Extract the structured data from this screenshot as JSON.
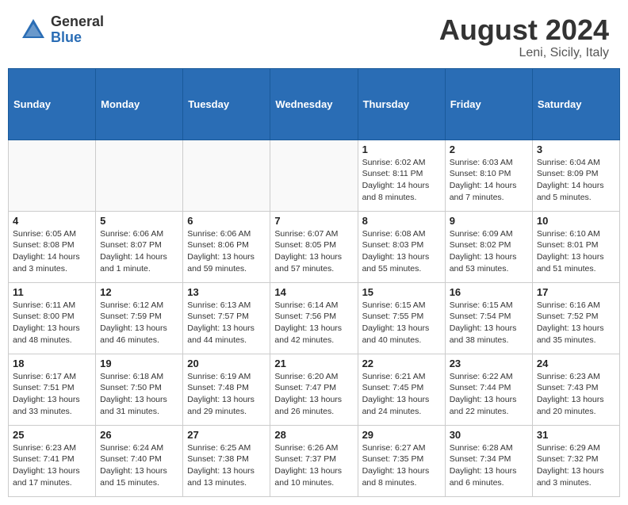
{
  "header": {
    "logo_general": "General",
    "logo_blue": "Blue",
    "month_title": "August 2024",
    "location": "Leni, Sicily, Italy"
  },
  "weekdays": [
    "Sunday",
    "Monday",
    "Tuesday",
    "Wednesday",
    "Thursday",
    "Friday",
    "Saturday"
  ],
  "weeks": [
    [
      {
        "day": "",
        "info": ""
      },
      {
        "day": "",
        "info": ""
      },
      {
        "day": "",
        "info": ""
      },
      {
        "day": "",
        "info": ""
      },
      {
        "day": "1",
        "info": "Sunrise: 6:02 AM\nSunset: 8:11 PM\nDaylight: 14 hours and 8 minutes."
      },
      {
        "day": "2",
        "info": "Sunrise: 6:03 AM\nSunset: 8:10 PM\nDaylight: 14 hours and 7 minutes."
      },
      {
        "day": "3",
        "info": "Sunrise: 6:04 AM\nSunset: 8:09 PM\nDaylight: 14 hours and 5 minutes."
      }
    ],
    [
      {
        "day": "4",
        "info": "Sunrise: 6:05 AM\nSunset: 8:08 PM\nDaylight: 14 hours and 3 minutes."
      },
      {
        "day": "5",
        "info": "Sunrise: 6:06 AM\nSunset: 8:07 PM\nDaylight: 14 hours and 1 minute."
      },
      {
        "day": "6",
        "info": "Sunrise: 6:06 AM\nSunset: 8:06 PM\nDaylight: 13 hours and 59 minutes."
      },
      {
        "day": "7",
        "info": "Sunrise: 6:07 AM\nSunset: 8:05 PM\nDaylight: 13 hours and 57 minutes."
      },
      {
        "day": "8",
        "info": "Sunrise: 6:08 AM\nSunset: 8:03 PM\nDaylight: 13 hours and 55 minutes."
      },
      {
        "day": "9",
        "info": "Sunrise: 6:09 AM\nSunset: 8:02 PM\nDaylight: 13 hours and 53 minutes."
      },
      {
        "day": "10",
        "info": "Sunrise: 6:10 AM\nSunset: 8:01 PM\nDaylight: 13 hours and 51 minutes."
      }
    ],
    [
      {
        "day": "11",
        "info": "Sunrise: 6:11 AM\nSunset: 8:00 PM\nDaylight: 13 hours and 48 minutes."
      },
      {
        "day": "12",
        "info": "Sunrise: 6:12 AM\nSunset: 7:59 PM\nDaylight: 13 hours and 46 minutes."
      },
      {
        "day": "13",
        "info": "Sunrise: 6:13 AM\nSunset: 7:57 PM\nDaylight: 13 hours and 44 minutes."
      },
      {
        "day": "14",
        "info": "Sunrise: 6:14 AM\nSunset: 7:56 PM\nDaylight: 13 hours and 42 minutes."
      },
      {
        "day": "15",
        "info": "Sunrise: 6:15 AM\nSunset: 7:55 PM\nDaylight: 13 hours and 40 minutes."
      },
      {
        "day": "16",
        "info": "Sunrise: 6:15 AM\nSunset: 7:54 PM\nDaylight: 13 hours and 38 minutes."
      },
      {
        "day": "17",
        "info": "Sunrise: 6:16 AM\nSunset: 7:52 PM\nDaylight: 13 hours and 35 minutes."
      }
    ],
    [
      {
        "day": "18",
        "info": "Sunrise: 6:17 AM\nSunset: 7:51 PM\nDaylight: 13 hours and 33 minutes."
      },
      {
        "day": "19",
        "info": "Sunrise: 6:18 AM\nSunset: 7:50 PM\nDaylight: 13 hours and 31 minutes."
      },
      {
        "day": "20",
        "info": "Sunrise: 6:19 AM\nSunset: 7:48 PM\nDaylight: 13 hours and 29 minutes."
      },
      {
        "day": "21",
        "info": "Sunrise: 6:20 AM\nSunset: 7:47 PM\nDaylight: 13 hours and 26 minutes."
      },
      {
        "day": "22",
        "info": "Sunrise: 6:21 AM\nSunset: 7:45 PM\nDaylight: 13 hours and 24 minutes."
      },
      {
        "day": "23",
        "info": "Sunrise: 6:22 AM\nSunset: 7:44 PM\nDaylight: 13 hours and 22 minutes."
      },
      {
        "day": "24",
        "info": "Sunrise: 6:23 AM\nSunset: 7:43 PM\nDaylight: 13 hours and 20 minutes."
      }
    ],
    [
      {
        "day": "25",
        "info": "Sunrise: 6:23 AM\nSunset: 7:41 PM\nDaylight: 13 hours and 17 minutes."
      },
      {
        "day": "26",
        "info": "Sunrise: 6:24 AM\nSunset: 7:40 PM\nDaylight: 13 hours and 15 minutes."
      },
      {
        "day": "27",
        "info": "Sunrise: 6:25 AM\nSunset: 7:38 PM\nDaylight: 13 hours and 13 minutes."
      },
      {
        "day": "28",
        "info": "Sunrise: 6:26 AM\nSunset: 7:37 PM\nDaylight: 13 hours and 10 minutes."
      },
      {
        "day": "29",
        "info": "Sunrise: 6:27 AM\nSunset: 7:35 PM\nDaylight: 13 hours and 8 minutes."
      },
      {
        "day": "30",
        "info": "Sunrise: 6:28 AM\nSunset: 7:34 PM\nDaylight: 13 hours and 6 minutes."
      },
      {
        "day": "31",
        "info": "Sunrise: 6:29 AM\nSunset: 7:32 PM\nDaylight: 13 hours and 3 minutes."
      }
    ]
  ]
}
